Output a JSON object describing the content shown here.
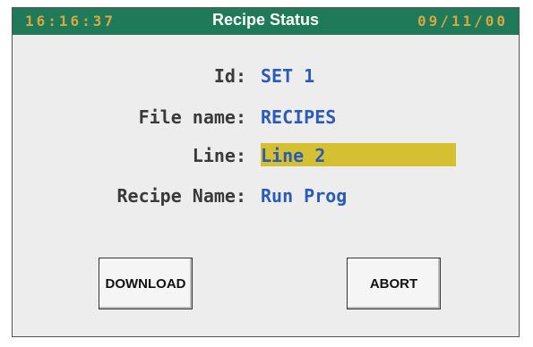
{
  "header": {
    "time": "16:16:37",
    "title": "Recipe Status",
    "date": "09/11/00"
  },
  "fields": {
    "id": {
      "label": "Id:",
      "value": "SET 1"
    },
    "file_name": {
      "label": "File name:",
      "value": "RECIPES"
    },
    "line": {
      "label": "Line:",
      "value": "Line 2"
    },
    "recipe_name": {
      "label": "Recipe Name:",
      "value": "Run Prog"
    }
  },
  "buttons": {
    "download": "DOWNLOAD",
    "abort": "ABORT"
  },
  "colors": {
    "titlebar": "#1f7a5a",
    "header_text": "#d9a640",
    "value_text": "#2a5bb8",
    "highlight": "#d4c030"
  }
}
